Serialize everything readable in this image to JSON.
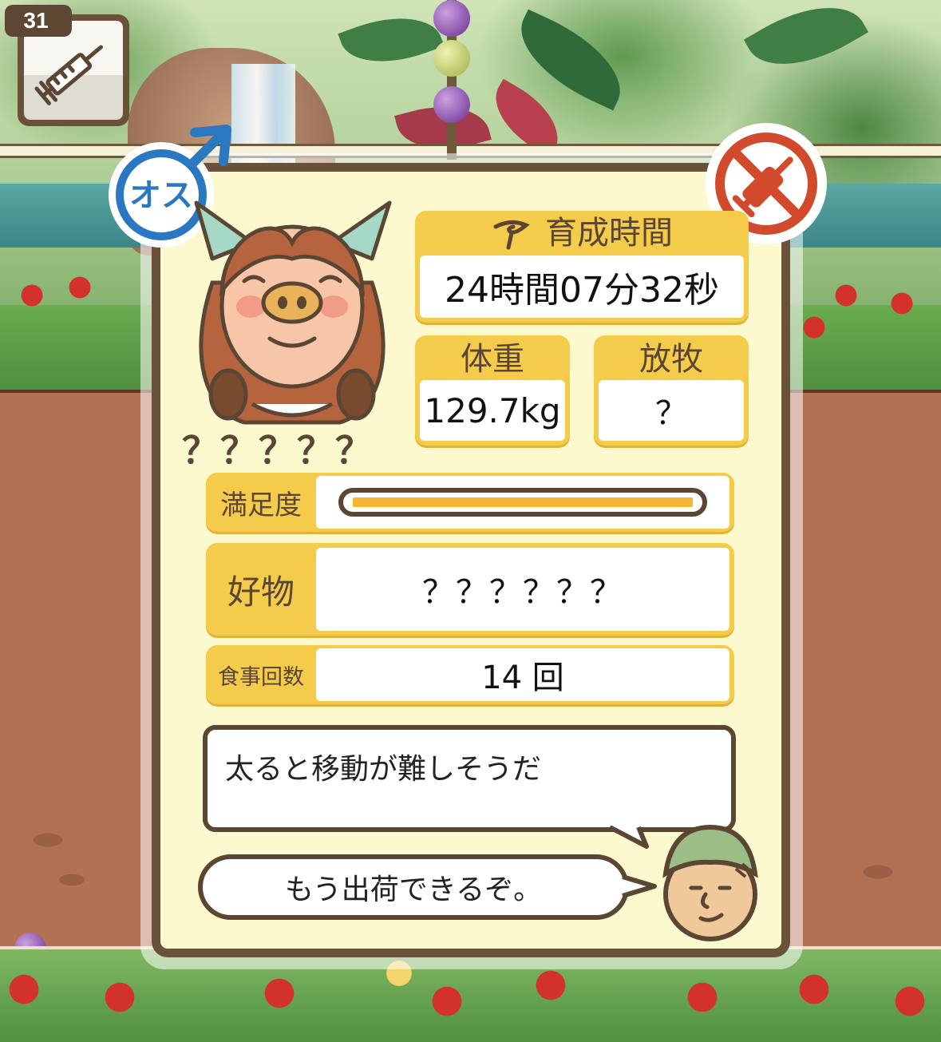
{
  "item_slot": {
    "count": "31",
    "icon": "syringe-icon"
  },
  "pig": {
    "gender_label": "オス",
    "name": "？？？？？",
    "status_badge_icon": "no-injection-icon"
  },
  "stats": {
    "growth_time": {
      "label": "育成時間",
      "value": "24時間07分32秒",
      "icon": "tail-icon"
    },
    "weight": {
      "label": "体重",
      "value": "129.7kg"
    },
    "grazing": {
      "label": "放牧",
      "value": "？"
    }
  },
  "satisfaction": {
    "label": "満足度",
    "level": 1.0
  },
  "favorite": {
    "label": "好物",
    "value": "？？？？？？"
  },
  "meals": {
    "label": "食事回数",
    "value": "14 回"
  },
  "comment": {
    "text": "太ると移動が難しそうだ"
  },
  "farmer_message": {
    "text": "もう出荷できるぞ。"
  },
  "colors": {
    "card_bg": "#fdf9cf",
    "card_border": "#6a5139",
    "label_bg": "#f4cb4a",
    "male_blue": "#2a78c2",
    "forbid_red": "#d24a2c"
  }
}
